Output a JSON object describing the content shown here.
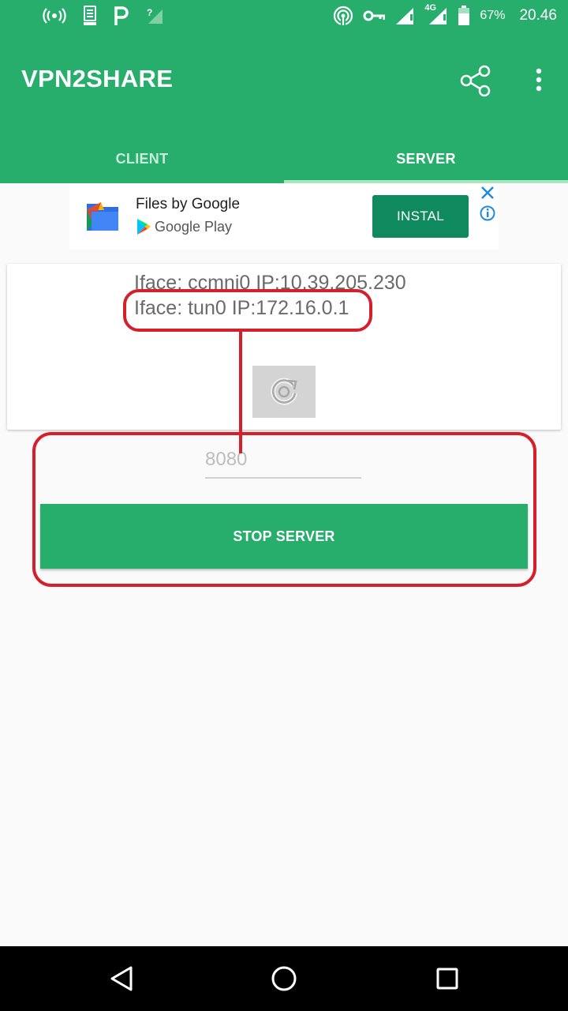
{
  "statusbar": {
    "battery": "67%",
    "time": "20.46",
    "network_label": "4G",
    "icons_left": [
      "hotspot-icon",
      "usb-debug-icon",
      "p-icon",
      "no-signal-icon"
    ],
    "icons_right": [
      "wifi-tethering-icon",
      "vpn-key-icon",
      "signal-icon",
      "signal-4g-icon",
      "battery-icon"
    ]
  },
  "appbar": {
    "title": "VPN2SHARE",
    "actions": [
      "share-icon",
      "more-vert-icon"
    ],
    "color": "#27ad6c"
  },
  "tabs": [
    {
      "label": "CLIENT",
      "selected": false
    },
    {
      "label": "SERVER",
      "selected": true
    }
  ],
  "ad": {
    "title": "Files by Google",
    "store": "Google Play",
    "install_label": "INSTAL",
    "install_color": "#0f8a5f"
  },
  "card": {
    "iface_lines": [
      "Iface: ccmni0 IP:10.39.205.230",
      "Iface: tun0 IP:172.16.0.1"
    ],
    "refresh_icon": "refresh-icon"
  },
  "server": {
    "port_placeholder": "8080",
    "port_value": "",
    "stop_label": "STOP SERVER"
  },
  "annotation": {
    "color": "#d3202b"
  },
  "navbar": {
    "buttons": [
      "back-icon",
      "home-icon",
      "recents-icon"
    ]
  }
}
